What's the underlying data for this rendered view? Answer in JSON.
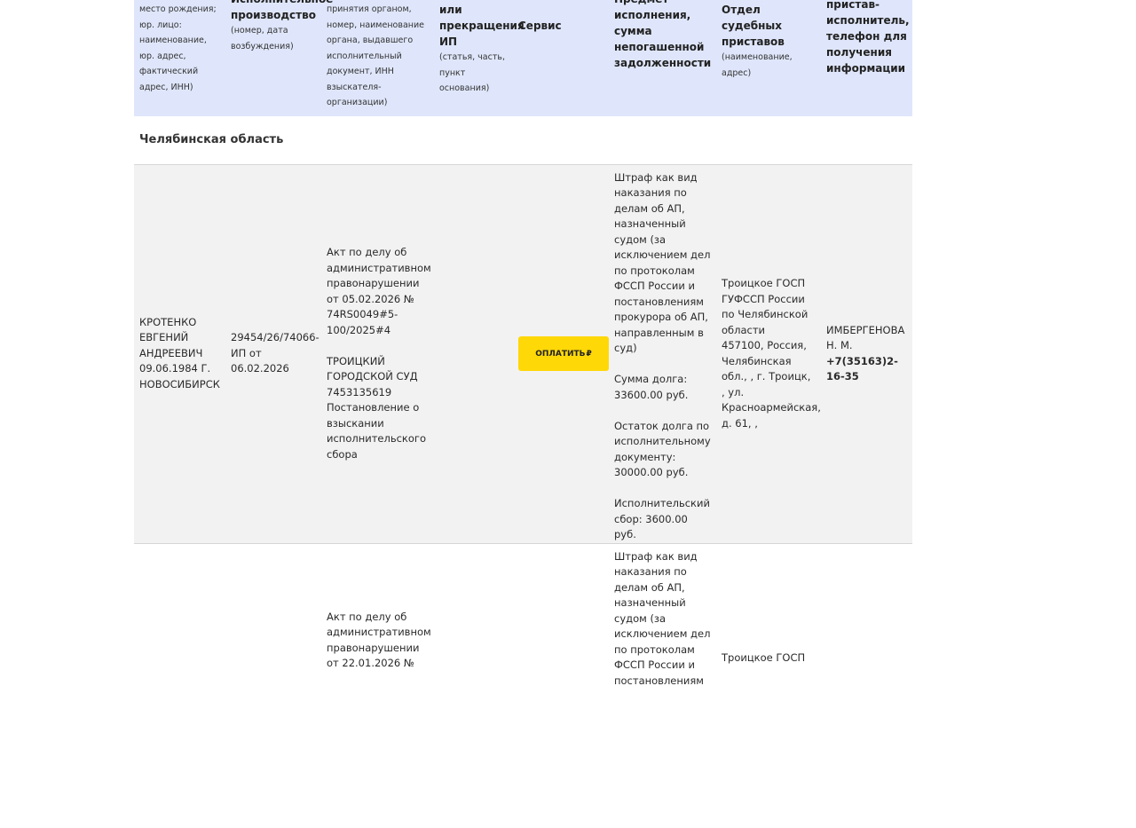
{
  "header": {
    "col1": {
      "title": "",
      "sub": "место рождения; юр. лицо: наименование, юр. адрес, фактический адрес, ИНН)"
    },
    "col2": {
      "title": "Исполнительное производство",
      "sub": "(номер, дата возбуждения)"
    },
    "col3": {
      "title": "",
      "sub": "принятия органом, номер, наименование органа, выдавшего исполнительный документ, ИНН взыскателя-организации)"
    },
    "col4": {
      "title": "или прекращения ИП",
      "sub": "(статья, часть, пункт основания)"
    },
    "col5": {
      "title": "Сервис"
    },
    "col6": {
      "title": "Предмет исполнения, сумма непогашенной задолженности"
    },
    "col7": {
      "title": "Отдел судебных приставов",
      "sub": "(наименование, адрес)"
    },
    "col8": {
      "title": "Судебный пристав-исполнитель, телефон для получения информации"
    }
  },
  "region": {
    "name": "Челябинская область"
  },
  "rows": [
    {
      "debtor": "КРОТЕНКО ЕВГЕНИЙ АНДРЕЕВИЧ 09.06.1984 Г. НОВОСИБИРСК",
      "proceeding": "29454/26/74066-ИП от 06.02.2026",
      "doc_act": "Акт по делу об административном правонарушении от 05.02.2026 № 74RS0049#5-100/2025#4",
      "doc_court": "ТРОИЦКИЙ ГОРОДСКОЙ СУД 7453135619",
      "doc_resolution": "Постановление о взыскании исполнительского сбора",
      "pay_label": "ОПЛАТИТЬ",
      "pay_symbol": "₽",
      "subject": "Штраф как вид наказания по делам об АП, назначенный судом (за исключением дел по протоколам ФССП России и постановлениям прокурора об АП, направленным в суд)",
      "debt_sum": "Сумма долга: 33600.00 руб.",
      "debt_rest": "Остаток долга по исполнительному документу: 30000.00 руб.",
      "debt_fee": "Исполнительский сбор: 3600.00 руб.",
      "department": "Троицкое ГОСП ГУФССП России по Челябинской области",
      "department_address": "457100, Россия, Челябинская обл., , г. Троицк, , ул. Красноармейская, д. 61, ,",
      "bailiff": "ИМБЕРГЕНОВА Н. М.",
      "phone": "+7(35163)2-16-35"
    },
    {
      "doc_act": "Акт по делу об административном правонарушении от 22.01.2026 №",
      "subject": "Штраф как вид наказания по делам об АП, назначенный судом (за исключением дел по протоколам ФССП России и постановлениям",
      "department": "Троицкое ГОСП"
    }
  ]
}
